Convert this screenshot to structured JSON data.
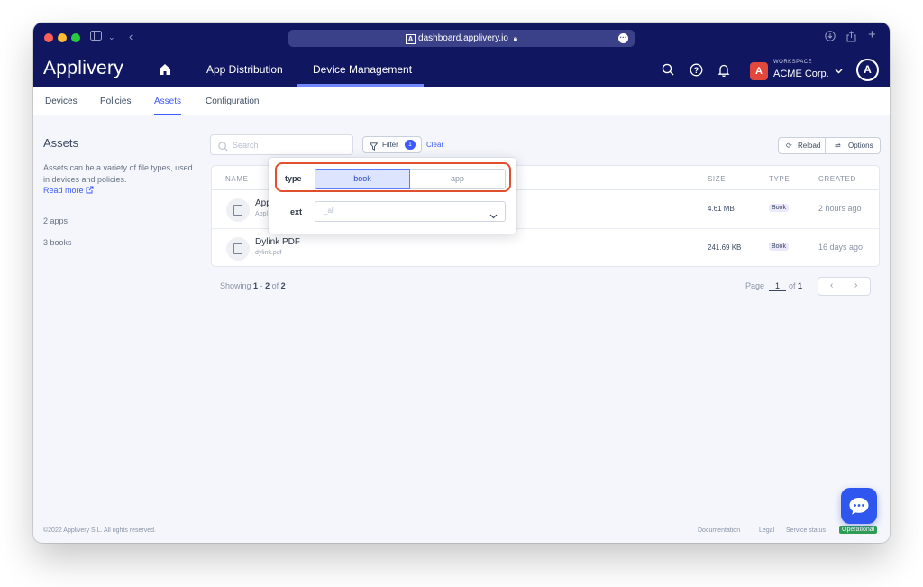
{
  "browser": {
    "url": "dashboard.applivery.io",
    "colors": {
      "close": "#ff5f57",
      "minimize": "#febc2e",
      "maximize": "#28c840"
    }
  },
  "header": {
    "brand": "Applivery",
    "nav": [
      {
        "label": "App Distribution"
      },
      {
        "label": "Device Management",
        "active": true
      }
    ],
    "workspace": {
      "caption": "WORKSPACE",
      "name": "ACME Corp.",
      "logo_letter": "A"
    },
    "avatar_letter": "A"
  },
  "subtabs": [
    {
      "label": "Devices"
    },
    {
      "label": "Policies"
    },
    {
      "label": "Assets",
      "active": true
    },
    {
      "label": "Configuration"
    }
  ],
  "sidebar": {
    "title": "Assets",
    "description": "Assets can be a variety of file types, used in devices and policies.",
    "read_more": "Read more",
    "counts": [
      "2 apps",
      "3 books"
    ]
  },
  "toolbar": {
    "search_placeholder": "Search",
    "filter_label": "Filter",
    "filter_count": "1",
    "clear_label": "Clear",
    "reload_label": "Reload",
    "options_label": "Options"
  },
  "filter_popover": {
    "type_label": "type",
    "type_options": [
      "book",
      "app"
    ],
    "type_selected": "book",
    "ext_label": "ext",
    "ext_value": "_all"
  },
  "table": {
    "columns": [
      "NAME",
      "SIZE",
      "TYPE",
      "CREATED"
    ],
    "rows": [
      {
        "name": "App",
        "file": "Appl",
        "size": "4.61 MB",
        "type": "Book",
        "created": "2 hours ago"
      },
      {
        "name": "Dylink PDF",
        "file": "dylink.pdf",
        "size": "241.69 KB",
        "type": "Book",
        "created": "16 days ago"
      }
    ]
  },
  "pagination": {
    "showing_prefix": "Showing",
    "from": "1",
    "sep": "-",
    "to": "2",
    "of_label": "of",
    "total": "2",
    "page_label": "Page",
    "page": "1",
    "of_pages_label": "of",
    "pages": "1"
  },
  "footer": {
    "copyright": "©2022 Applivery S.L. All rights reserved.",
    "links": [
      "Documentation",
      "Legal",
      "Service status"
    ],
    "status": "Operational"
  }
}
